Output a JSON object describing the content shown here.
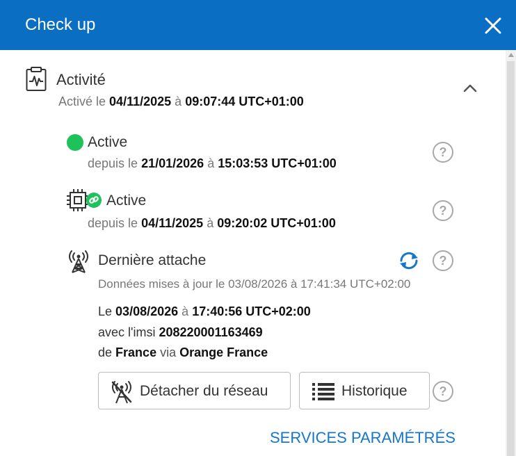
{
  "header": {
    "title": "Check up"
  },
  "activity": {
    "title": "Activité",
    "activated_prefix": "Activé le",
    "activated_date": "04/11/2025",
    "activated_sep": "à",
    "activated_time": "09:07:44 UTC+01:00"
  },
  "status_line": {
    "label": "Active",
    "prefix": "depuis le",
    "date": "21/01/2026",
    "sep": "à",
    "time": "15:03:53 UTC+01:00"
  },
  "device_line": {
    "label": "Active",
    "prefix": "depuis le",
    "date": "04/11/2025",
    "sep": "à",
    "time": "09:20:02 UTC+01:00"
  },
  "attach": {
    "title": "Dernière attache",
    "updated": "Données mises à jour le 03/08/2026 à 17:41:34 UTC+02:00",
    "le_prefix": "Le",
    "date": "03/08/2026",
    "sep": "à",
    "time": "17:40:56 UTC+02:00",
    "imsi_prefix": "avec l'imsi",
    "imsi": "208220001163469",
    "country_prefix": "de",
    "country": "France",
    "via_word": "via",
    "operator": "Orange France"
  },
  "buttons": {
    "detach": "Détacher du réseau",
    "history": "Historique"
  },
  "help_glyph": "?",
  "link": {
    "services": "SERVICES PARAMÉTRÉS"
  },
  "colors": {
    "header": "#0a6fc2",
    "accent": "#1577c9",
    "status_green": "#1fc15a"
  },
  "icons": [
    "close-icon",
    "clipboard-activity-icon",
    "chevron-up-icon",
    "status-dot-icon",
    "chip-link-icon",
    "antenna-icon",
    "refresh-icon",
    "help-icon",
    "antenna-off-icon",
    "list-icon"
  ]
}
